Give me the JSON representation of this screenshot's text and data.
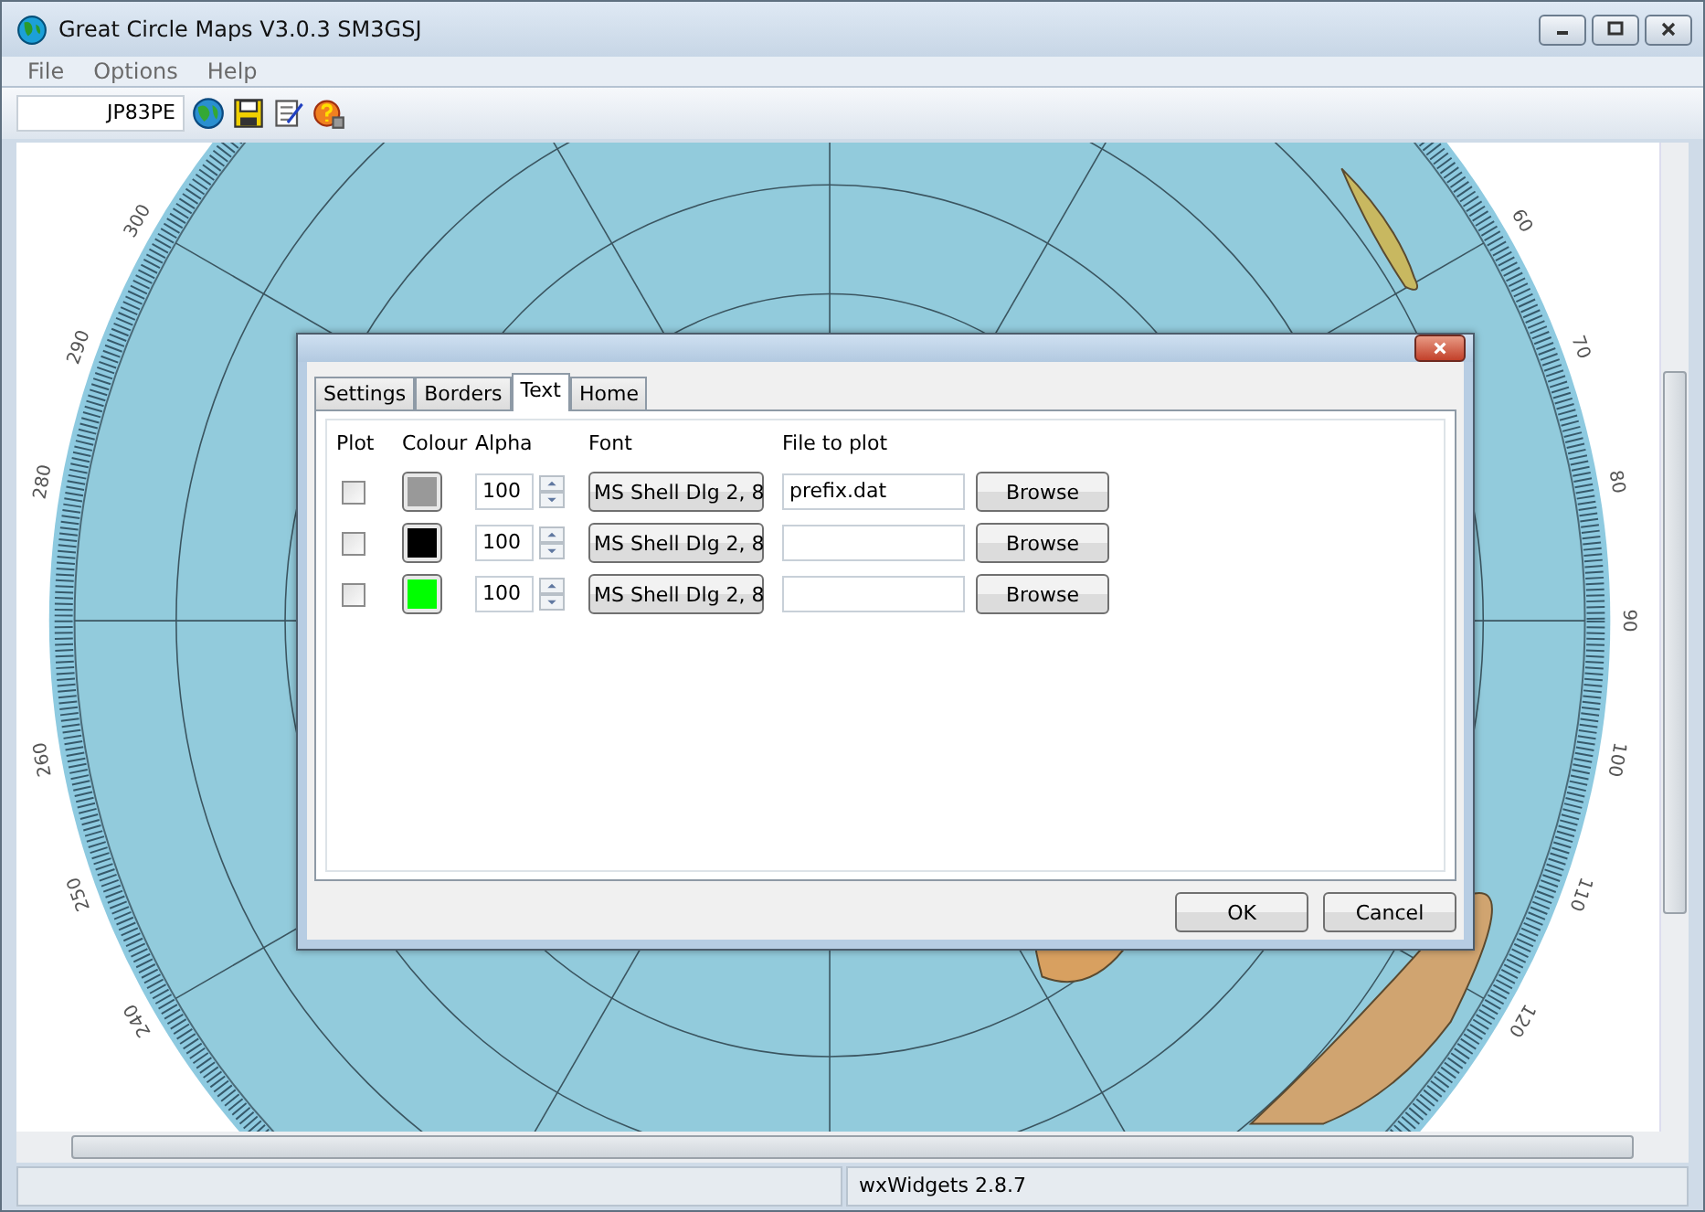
{
  "window": {
    "title": "Great Circle Maps V3.0.3 SM3GSJ"
  },
  "menu": [
    "File",
    "Options",
    "Help"
  ],
  "toolbar": {
    "locator": "JP83PE"
  },
  "map": {
    "bearing_labels": [
      "300",
      "290",
      "280",
      "260",
      "250",
      "240",
      "60",
      "70",
      "80",
      "90",
      "100",
      "110",
      "120"
    ]
  },
  "dialog": {
    "tabs": [
      {
        "label": "Settings",
        "selected": false
      },
      {
        "label": "Borders",
        "selected": false
      },
      {
        "label": "Text",
        "selected": true
      },
      {
        "label": "Home",
        "selected": false
      }
    ],
    "columns": [
      "Plot",
      "Colour",
      "Alpha",
      "Font",
      "File to plot"
    ],
    "rows": [
      {
        "checked": false,
        "color": "#999999",
        "alpha": "100",
        "font": "MS Shell Dlg 2, 8",
        "file": "prefix.dat",
        "browse": "Browse"
      },
      {
        "checked": false,
        "color": "#000000",
        "alpha": "100",
        "font": "MS Shell Dlg 2, 8",
        "browse": "Browse"
      },
      {
        "checked": false,
        "color": "#00ff00",
        "alpha": "100",
        "font": "MS Shell Dlg 2, 8",
        "browse": "Browse"
      }
    ],
    "buttons": [
      "OK",
      "Cancel"
    ]
  },
  "status_bar": {
    "text": "wxWidgets 2.8.7"
  }
}
